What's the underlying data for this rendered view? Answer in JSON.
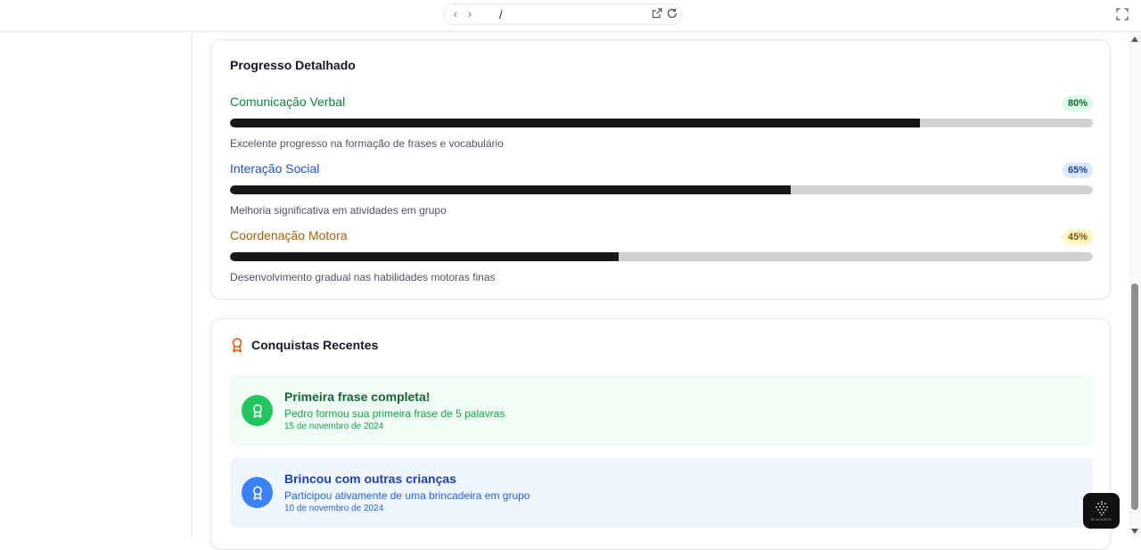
{
  "browser": {
    "url_path": "/",
    "icons": [
      "chevron-left-icon",
      "chevron-right-icon",
      "external-link-icon",
      "reload-icon",
      "fullscreen-icon"
    ]
  },
  "progress": {
    "title": "Progresso Detalhado",
    "metrics": [
      {
        "label": "Comunicação Verbal",
        "value": 80,
        "badge": "80%",
        "description": "Excelente progresso na formação de frases e vocabulário",
        "color": "#15803d"
      },
      {
        "label": "Interação Social",
        "value": 65,
        "badge": "65%",
        "description": "Melhoria significativa em atividades em grupo",
        "color": "#1d4ed8"
      },
      {
        "label": "Coordenação Motora",
        "value": 45,
        "badge": "45%",
        "description": "Desenvolvimento gradual nas habilidades motoras finas",
        "color": "#a16207"
      }
    ]
  },
  "achievements": {
    "title": "Conquistas Recentes",
    "title_icon": "award-icon",
    "title_icon_color": "#ea580c",
    "items": [
      {
        "title": "Primeira frase completa!",
        "description": "Pedro formou sua primeira frase de 5 palavras",
        "date": "15 de novembro de 2024",
        "icon": "award-icon",
        "color": "#22c55e"
      },
      {
        "title": "Brincou com outras crianças",
        "description": "Participou ativamente de uma brincadeira em grupo",
        "date": "10 de novembro de 2024",
        "icon": "award-icon",
        "color": "#3b82f6"
      }
    ]
  },
  "floating_badge": {
    "label": "BLACKBOX",
    "icon": "grid-dots-icon"
  }
}
